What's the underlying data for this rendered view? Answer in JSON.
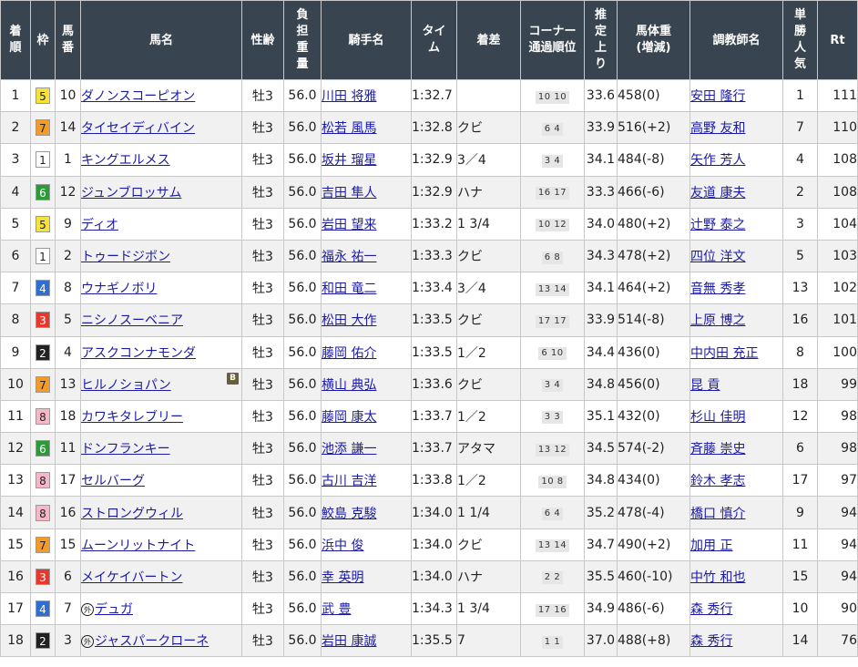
{
  "headers": {
    "rank": [
      "着",
      "順"
    ],
    "waku": "枠",
    "umaban": [
      "馬",
      "番"
    ],
    "horse": "馬名",
    "sexage": "性齢",
    "weight": [
      "負",
      "担",
      "重",
      "量"
    ],
    "jockey": "騎手名",
    "time": [
      "タイ",
      "ム"
    ],
    "margin": "着差",
    "corner": [
      "コーナー",
      "通過順位"
    ],
    "last3f": [
      "推",
      "定",
      "上",
      "り"
    ],
    "body": [
      "馬体重",
      "(増減)"
    ],
    "trainer": "調教師名",
    "pop": [
      "単",
      "勝",
      "人",
      "気"
    ],
    "rt": "Rt"
  },
  "waku_colors": {
    "1": {
      "bg": "#ffffff",
      "fg": "#222222"
    },
    "2": {
      "bg": "#222222",
      "fg": "#ffffff"
    },
    "3": {
      "bg": "#e8382e",
      "fg": "#ffffff"
    },
    "4": {
      "bg": "#2f6fd1",
      "fg": "#ffffff"
    },
    "5": {
      "bg": "#f6e33a",
      "fg": "#222222"
    },
    "6": {
      "bg": "#2d9a3a",
      "fg": "#ffffff"
    },
    "7": {
      "bg": "#f39a28",
      "fg": "#222222"
    },
    "8": {
      "bg": "#f6b7c9",
      "fg": "#222222"
    }
  },
  "rows": [
    {
      "rank": "1",
      "waku": "5",
      "umaban": "10",
      "mark": "",
      "horse": "ダノンスコーピオン",
      "blinker": "",
      "sexage": "牡3",
      "weight": "56.0",
      "jockey": "川田 将雅",
      "time": "1:32.7",
      "margin": "",
      "corner": "10 10",
      "last3f": "33.6",
      "body": "458(0)",
      "trainer": "安田 隆行",
      "pop": "1",
      "rt": "111"
    },
    {
      "rank": "2",
      "waku": "7",
      "umaban": "14",
      "mark": "",
      "horse": "タイセイディバイン",
      "blinker": "",
      "sexage": "牡3",
      "weight": "56.0",
      "jockey": "松若 風馬",
      "time": "1:32.8",
      "margin": "クビ",
      "corner": "6 4",
      "last3f": "33.9",
      "body": "516(+2)",
      "trainer": "高野 友和",
      "pop": "7",
      "rt": "110"
    },
    {
      "rank": "3",
      "waku": "1",
      "umaban": "1",
      "mark": "",
      "horse": "キングエルメス",
      "blinker": "",
      "sexage": "牡3",
      "weight": "56.0",
      "jockey": "坂井 瑠星",
      "time": "1:32.9",
      "margin": "3／4",
      "corner": "3 4",
      "last3f": "34.1",
      "body": "484(-8)",
      "trainer": "矢作 芳人",
      "pop": "4",
      "rt": "108"
    },
    {
      "rank": "4",
      "waku": "6",
      "umaban": "12",
      "mark": "",
      "horse": "ジュンブロッサム",
      "blinker": "",
      "sexage": "牡3",
      "weight": "56.0",
      "jockey": "吉田 隼人",
      "time": "1:32.9",
      "margin": "ハナ",
      "corner": "16 17",
      "last3f": "33.3",
      "body": "466(-6)",
      "trainer": "友道 康夫",
      "pop": "2",
      "rt": "108"
    },
    {
      "rank": "5",
      "waku": "5",
      "umaban": "9",
      "mark": "",
      "horse": "ディオ",
      "blinker": "",
      "sexage": "牡3",
      "weight": "56.0",
      "jockey": "岩田 望来",
      "time": "1:33.2",
      "margin": "1 3/4",
      "corner": "10 12",
      "last3f": "34.0",
      "body": "480(+2)",
      "trainer": "辻野 泰之",
      "pop": "3",
      "rt": "104"
    },
    {
      "rank": "6",
      "waku": "1",
      "umaban": "2",
      "mark": "",
      "horse": "トゥードジボン",
      "blinker": "",
      "sexage": "牡3",
      "weight": "56.0",
      "jockey": "福永 祐一",
      "time": "1:33.3",
      "margin": "クビ",
      "corner": "6 8",
      "last3f": "34.3",
      "body": "478(+2)",
      "trainer": "四位 洋文",
      "pop": "5",
      "rt": "103"
    },
    {
      "rank": "7",
      "waku": "4",
      "umaban": "8",
      "mark": "",
      "horse": "ウナギノボリ",
      "blinker": "",
      "sexage": "牡3",
      "weight": "56.0",
      "jockey": "和田 竜二",
      "time": "1:33.4",
      "margin": "3／4",
      "corner": "13 14",
      "last3f": "34.1",
      "body": "464(+2)",
      "trainer": "音無 秀孝",
      "pop": "13",
      "rt": "102"
    },
    {
      "rank": "8",
      "waku": "3",
      "umaban": "5",
      "mark": "",
      "horse": "ニシノスーベニア",
      "blinker": "",
      "sexage": "牡3",
      "weight": "56.0",
      "jockey": "松田 大作",
      "time": "1:33.5",
      "margin": "クビ",
      "corner": "17 17",
      "last3f": "33.9",
      "body": "514(-8)",
      "trainer": "上原 博之",
      "pop": "16",
      "rt": "101"
    },
    {
      "rank": "9",
      "waku": "2",
      "umaban": "4",
      "mark": "",
      "horse": "アスクコンナモンダ",
      "blinker": "",
      "sexage": "牡3",
      "weight": "56.0",
      "jockey": "藤岡 佑介",
      "time": "1:33.5",
      "margin": "1／2",
      "corner": "6 10",
      "last3f": "34.4",
      "body": "436(0)",
      "trainer": "中内田 充正",
      "pop": "8",
      "rt": "100"
    },
    {
      "rank": "10",
      "waku": "7",
      "umaban": "13",
      "mark": "",
      "horse": "ヒルノショパン",
      "blinker": "B",
      "sexage": "牡3",
      "weight": "56.0",
      "jockey": "横山 典弘",
      "time": "1:33.6",
      "margin": "クビ",
      "corner": "3 4",
      "last3f": "34.8",
      "body": "456(0)",
      "trainer": "昆 貢",
      "pop": "18",
      "rt": "99"
    },
    {
      "rank": "11",
      "waku": "8",
      "umaban": "18",
      "mark": "",
      "horse": "カワキタレブリー",
      "blinker": "",
      "sexage": "牡3",
      "weight": "56.0",
      "jockey": "藤岡 康太",
      "time": "1:33.7",
      "margin": "1／2",
      "corner": "3 3",
      "last3f": "35.1",
      "body": "432(0)",
      "trainer": "杉山 佳明",
      "pop": "12",
      "rt": "98"
    },
    {
      "rank": "12",
      "waku": "6",
      "umaban": "11",
      "mark": "",
      "horse": "ドンフランキー",
      "blinker": "",
      "sexage": "牡3",
      "weight": "56.0",
      "jockey": "池添 謙一",
      "time": "1:33.7",
      "margin": "アタマ",
      "corner": "13 12",
      "last3f": "34.5",
      "body": "574(-2)",
      "trainer": "斉藤 崇史",
      "pop": "6",
      "rt": "98"
    },
    {
      "rank": "13",
      "waku": "8",
      "umaban": "17",
      "mark": "",
      "horse": "セルバーグ",
      "blinker": "",
      "sexage": "牡3",
      "weight": "56.0",
      "jockey": "古川 吉洋",
      "time": "1:33.8",
      "margin": "1／2",
      "corner": "10 8",
      "last3f": "34.8",
      "body": "434(0)",
      "trainer": "鈴木 孝志",
      "pop": "17",
      "rt": "97"
    },
    {
      "rank": "14",
      "waku": "8",
      "umaban": "16",
      "mark": "",
      "horse": "ストロングウィル",
      "blinker": "",
      "sexage": "牡3",
      "weight": "56.0",
      "jockey": "鮫島 克駿",
      "time": "1:34.0",
      "margin": "1 1/4",
      "corner": "6 4",
      "last3f": "35.2",
      "body": "478(-4)",
      "trainer": "橋口 慎介",
      "pop": "9",
      "rt": "94"
    },
    {
      "rank": "15",
      "waku": "7",
      "umaban": "15",
      "mark": "",
      "horse": "ムーンリットナイト",
      "blinker": "",
      "sexage": "牡3",
      "weight": "56.0",
      "jockey": "浜中 俊",
      "time": "1:34.0",
      "margin": "クビ",
      "corner": "13 14",
      "last3f": "34.7",
      "body": "490(+2)",
      "trainer": "加用 正",
      "pop": "11",
      "rt": "94"
    },
    {
      "rank": "16",
      "waku": "3",
      "umaban": "6",
      "mark": "",
      "horse": "メイケイバートン",
      "blinker": "",
      "sexage": "牡3",
      "weight": "56.0",
      "jockey": "幸 英明",
      "time": "1:34.0",
      "margin": "ハナ",
      "corner": "2 2",
      "last3f": "35.5",
      "body": "460(-10)",
      "trainer": "中竹 和也",
      "pop": "15",
      "rt": "94"
    },
    {
      "rank": "17",
      "waku": "4",
      "umaban": "7",
      "mark": "外",
      "horse": "デュガ",
      "blinker": "",
      "sexage": "牡3",
      "weight": "56.0",
      "jockey": "武 豊",
      "time": "1:34.3",
      "margin": "1 3/4",
      "corner": "17 16",
      "last3f": "34.9",
      "body": "486(-6)",
      "trainer": "森 秀行",
      "pop": "10",
      "rt": "90"
    },
    {
      "rank": "18",
      "waku": "2",
      "umaban": "3",
      "mark": "外",
      "horse": "ジャスパークローネ",
      "blinker": "",
      "sexage": "牡3",
      "weight": "56.0",
      "jockey": "岩田 康誠",
      "time": "1:35.5",
      "margin": "7",
      "corner": "1 1",
      "last3f": "37.0",
      "body": "488(+8)",
      "trainer": "森 秀行",
      "pop": "14",
      "rt": "76"
    }
  ]
}
